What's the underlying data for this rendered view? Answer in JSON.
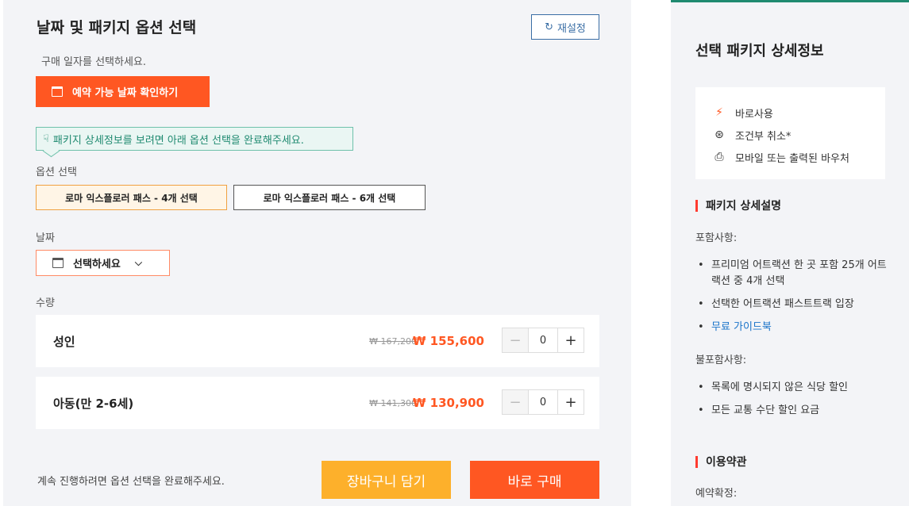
{
  "left": {
    "title": "날짜 및 패키지 옵션 선택",
    "reset_label": "재설정",
    "purchase_date_instruction": "구매 일자를 선택하세요.",
    "check_date_label": "예약 가능 날짜 확인하기",
    "notice": "패키지 상세정보를 보려면 아래 옵션 선택을 완료해주세요.",
    "option_label": "옵션 선택",
    "options": [
      {
        "label": "로마 익스플로러 패스 - 4개 선택",
        "selected": true
      },
      {
        "label": "로마 익스플로러 패스 - 6개 선택",
        "selected": false
      }
    ],
    "date_label": "날짜",
    "date_placeholder": "선택하세요",
    "quantity_label": "수량",
    "rows": [
      {
        "name": "성인",
        "old_price": "₩ 167,200",
        "new_price": "₩ 155,600",
        "qty": "0"
      },
      {
        "name": "아동(만 2-6세)",
        "old_price": "₩ 141,300",
        "new_price": "₩ 130,900",
        "qty": "0"
      }
    ],
    "footer_message": "계속 진행하려면 옵션 선택을 완료해주세요.",
    "cart_label": "장바구니 담기",
    "buy_label": "바로 구매"
  },
  "right": {
    "title": "선택 패키지 상세정보",
    "features": [
      {
        "icon": "bolt-icon",
        "label": "바로사용"
      },
      {
        "icon": "refund-icon",
        "label": "조건부 취소*"
      },
      {
        "icon": "voucher-icon",
        "label": "모바일 또는 출력된 바우처"
      }
    ],
    "package_desc_heading": "패키지 상세설명",
    "included_label": "포함사항:",
    "included": [
      "프리미엄 어트랙션 한 곳 포함 25개 어트랙션 중 4개 선택",
      "선택한 어트랙션 패스트트랙 입장",
      "무료 가이드북"
    ],
    "excluded_label": "불포함사항:",
    "excluded": [
      "목록에 명시되지 않은 식당 할인",
      "모든 교통 수단 할인 요금"
    ],
    "terms_heading": "이용약관",
    "booking_confirm_label": "예약확정:"
  },
  "colors": {
    "accent": "#ff5722",
    "cart": "#fdb02b",
    "notice_green": "#1f8a70",
    "link": "#1a73c9"
  }
}
